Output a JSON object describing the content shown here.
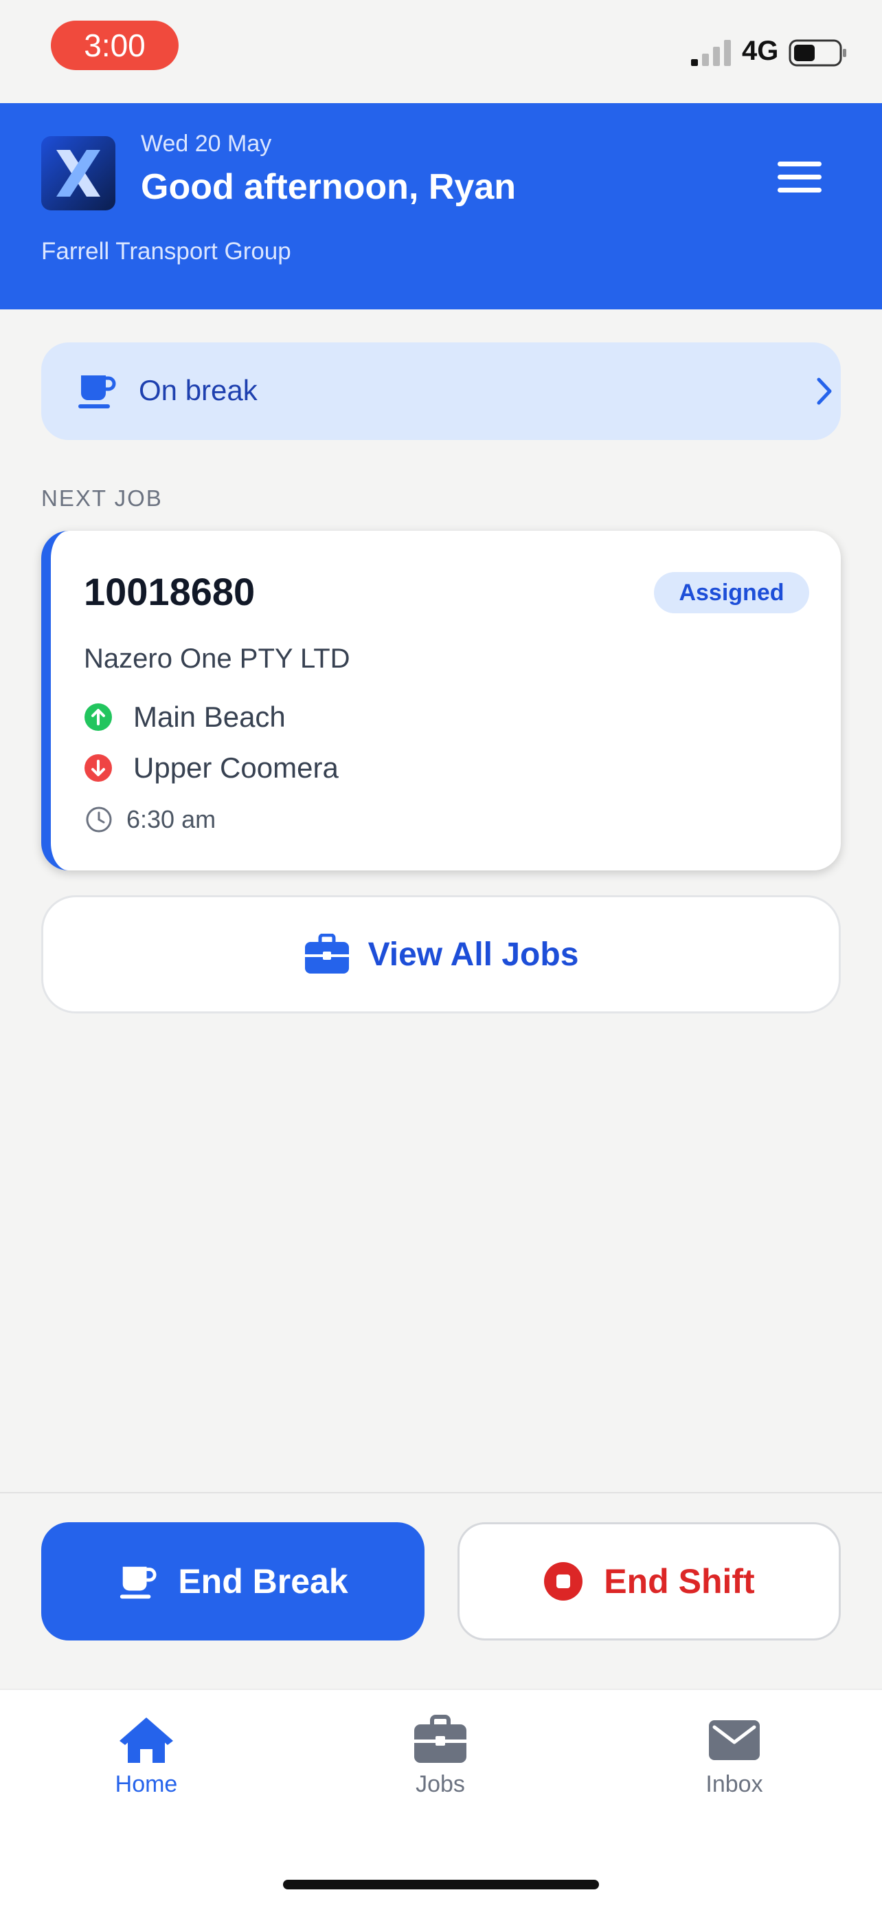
{
  "status_bar": {
    "time": "3:00",
    "network": "4G"
  },
  "header": {
    "date": "Wed 20 May",
    "greeting": "Good afternoon, Ryan",
    "company": "Farrell Transport Group"
  },
  "break_banner": {
    "label": "On break",
    "icon": "coffee-cup-icon"
  },
  "next_job": {
    "section_label": "NEXT JOB",
    "job_number": "10018680",
    "status": "Assigned",
    "customer": "Nazero One PTY LTD",
    "pickup": "Main Beach",
    "dropoff": "Upper Coomera",
    "time": "6:30 am"
  },
  "view_all": {
    "label": "View All Jobs",
    "icon": "briefcase-icon"
  },
  "actions": {
    "end_break": "End Break",
    "end_shift": "End Shift"
  },
  "tabs": [
    {
      "label": "Home",
      "icon": "home-icon",
      "active": true
    },
    {
      "label": "Jobs",
      "icon": "briefcase-icon",
      "active": false
    },
    {
      "label": "Inbox",
      "icon": "mail-icon",
      "active": false
    }
  ],
  "colors": {
    "primary": "#2563eb",
    "banner_bg": "#dbe8fd",
    "danger": "#dc2626",
    "pickup": "#22c55e",
    "dropoff": "#ef4444"
  }
}
